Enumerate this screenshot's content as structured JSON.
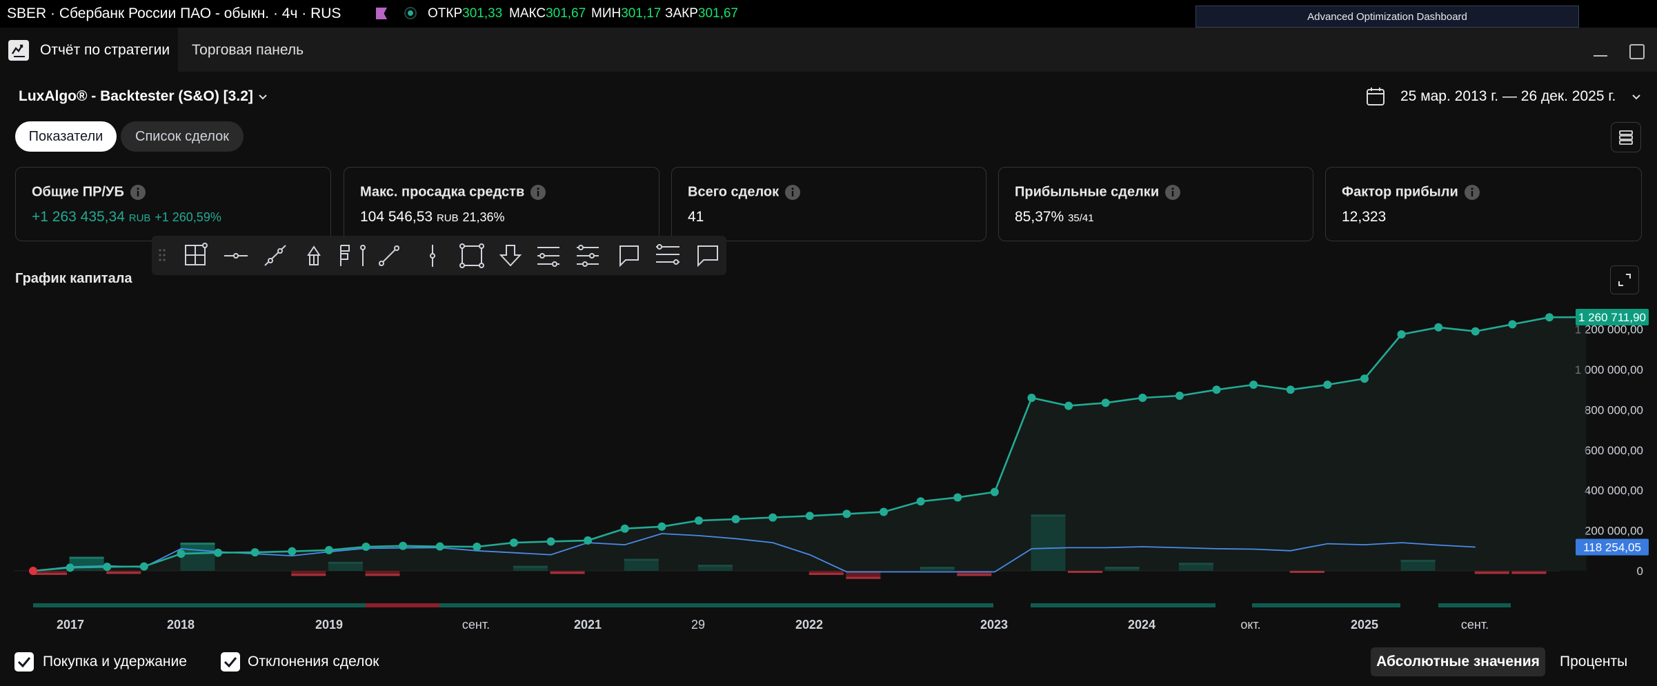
{
  "header": {
    "symbol_title": "SBER · Сбербанк России ПАО - обыкн. · 4ч · RUS",
    "ohlc": [
      {
        "label": "ОТКР",
        "value": "301,33"
      },
      {
        "label": "МАКС",
        "value": "301,67"
      },
      {
        "label": "МИН",
        "value": "301,17"
      },
      {
        "label": "ЗАКР",
        "value": "301,67"
      }
    ],
    "advanced_dashboard": "Advanced Optimization Dashboard"
  },
  "tabs": {
    "report": "Отчёт по стратегии",
    "trading_panel": "Торговая панель"
  },
  "strategy": {
    "name": "LuxAlgo® - Backtester (S&O) [3.2]",
    "date_range": "25 мар. 2013 г. — 26 дек. 2025 г."
  },
  "view_tabs": {
    "metrics": "Показатели",
    "trades_list": "Список сделок"
  },
  "cards": [
    {
      "title": "Общие ПР/УБ",
      "value": "+1 263 435,34",
      "unit": "RUB",
      "extra": "+1 260,59%"
    },
    {
      "title": "Макс. просадка средств",
      "value": "104 546,53",
      "unit": "RUB",
      "extra": "21,36%"
    },
    {
      "title": "Всего сделок",
      "value": "41",
      "unit": "",
      "extra": ""
    },
    {
      "title": "Прибыльные сделки",
      "value": "85,37%",
      "unit": "",
      "extra": "35/41"
    },
    {
      "title": "Фактор прибыли",
      "value": "12,323",
      "unit": "",
      "extra": ""
    }
  ],
  "toolbar_icons": [
    "grip-icon",
    "measure-icon",
    "horizontal-line-icon",
    "trend-line-icon",
    "arrow-up-icon",
    "long-position-icon",
    "ray-icon",
    "vertical-line-icon",
    "rectangle-icon",
    "arrow-down-icon",
    "fib-retracement-icon",
    "regression-trend-icon",
    "callout-icon",
    "parallel-channel-icon",
    "comment-icon"
  ],
  "chart": {
    "title": "График капитала"
  },
  "chart_data": {
    "type": "line",
    "x": [
      1,
      2,
      3,
      4,
      5,
      6,
      7,
      8,
      9,
      10,
      11,
      12,
      13,
      14,
      15,
      16,
      17,
      18,
      19,
      20,
      21,
      22,
      23,
      24,
      25,
      26,
      27,
      28,
      29,
      30,
      31,
      32,
      33,
      34,
      35,
      36,
      37,
      38,
      39,
      40,
      41,
      42
    ],
    "series": [
      {
        "values": [
          0,
          16000,
          20000,
          22000,
          85000,
          90000,
          92000,
          97000,
          103000,
          120000,
          124000,
          121000,
          120000,
          140000,
          146000,
          151000,
          210000,
          220000,
          250000,
          257000,
          265000,
          273000,
          283000,
          293000,
          345000,
          365000,
          392000,
          860000,
          820000,
          835000,
          860000,
          870000,
          900000,
          925000,
          900000,
          925000,
          955000,
          1175000,
          1210000,
          1190000,
          1225000,
          1260000,
          1260712
        ]
      },
      {
        "values": [
          0,
          20000,
          25000,
          18000,
          110000,
          95000,
          85000,
          75000,
          95000,
          112000,
          114000,
          115000,
          100000,
          90000,
          80000,
          140000,
          130000,
          185000,
          175000,
          160000,
          140000,
          80000,
          -5000,
          -5000,
          -5000,
          -5000,
          -5000,
          110000,
          115000,
          115000,
          120000,
          115000,
          110000,
          108000,
          100000,
          135000,
          130000,
          140000,
          128000,
          118254
        ]
      }
    ],
    "bars": [
      -20000,
      70000,
      -15000,
      0,
      140000,
      0,
      0,
      -25000,
      45000,
      -25000,
      0,
      0,
      0,
      25000,
      -15000,
      0,
      60000,
      0,
      30000,
      0,
      0,
      -20000,
      -40000,
      0,
      20000,
      -25000,
      0,
      280000,
      -10000,
      20000,
      0,
      40000,
      0,
      0,
      -10000,
      0,
      0,
      55000,
      0,
      -15000,
      -15000,
      0
    ],
    "x_tick_labels": [
      "2017",
      "2018",
      "2019",
      "сент.",
      "2021",
      "29",
      "2022",
      "2023",
      "2024",
      "окт.",
      "2025",
      "сент."
    ],
    "y_tick_labels": [
      "0",
      "200 000,00",
      "400 000,00",
      "600 000,00",
      "800 000,00",
      "1 000 000,00",
      "1 200 000,00"
    ],
    "ylim": [
      -50000,
      1300000
    ],
    "last_value_labels": [
      "1 260 711,90",
      "118 254,05"
    ],
    "colors": {
      "equity": "#22ab94",
      "buy_hold": "#4c8ae8",
      "loss": "#b82c36"
    }
  },
  "footer": {
    "buy_hold": "Покупка и удержание",
    "trade_deviation": "Отклонения сделок",
    "absolute": "Абсолютные значения",
    "percent": "Проценты"
  }
}
